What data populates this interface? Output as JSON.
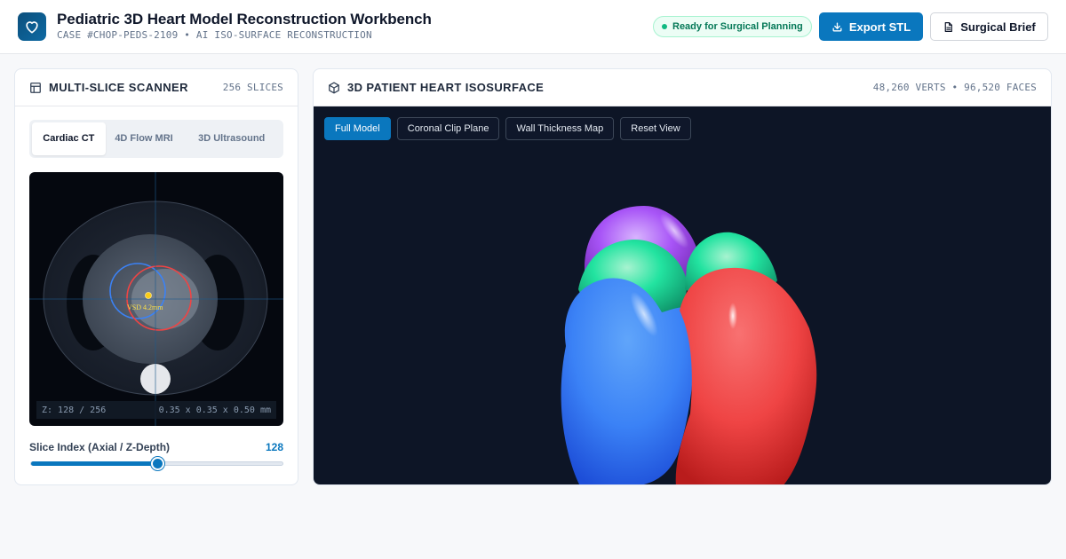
{
  "header": {
    "title": "Pediatric 3D Heart Model Reconstruction Workbench",
    "subtitle": "CASE #CHOP-PEDS-2109 • AI ISO-SURFACE RECONSTRUCTION",
    "status": "Ready for Surgical Planning",
    "export_label": "Export STL",
    "brief_label": "Surgical Brief",
    "icons": {
      "logo": "heart-icon",
      "export": "download-icon",
      "brief": "document-icon"
    }
  },
  "scanner_panel": {
    "title": "MULTI-SLICE SCANNER",
    "meta": "256 SLICES",
    "tabs": [
      {
        "label": "Cardiac CT",
        "active": true
      },
      {
        "label": "4D Flow MRI",
        "active": false
      },
      {
        "label": "3D Ultrasound",
        "active": false
      }
    ],
    "annotation": "VSD 4.2mm",
    "readout_z": "Z: 128 / 256",
    "readout_voxel": "0.35 x 0.35 x 0.50 mm",
    "slider_label": "Slice Index (Axial / Z-Depth)",
    "slider_value": "128",
    "slider_fraction": 0.5
  },
  "model_panel": {
    "title": "3D PATIENT HEART ISOSURFACE",
    "meta": "48,260 VERTS • 96,520 FACES",
    "view_buttons": [
      {
        "label": "Full Model",
        "active": true
      },
      {
        "label": "Coronal Clip Plane",
        "active": false
      },
      {
        "label": "Wall Thickness Map",
        "active": false
      },
      {
        "label": "Reset View",
        "active": false
      }
    ]
  },
  "colors": {
    "accent": "#0a77be",
    "status_green": "#047857",
    "heart_right_ventricle": "#3b82f6",
    "heart_left_ventricle": "#ef4444",
    "heart_atria": "#22e3a0",
    "heart_great_vessel": "#a855f7"
  }
}
